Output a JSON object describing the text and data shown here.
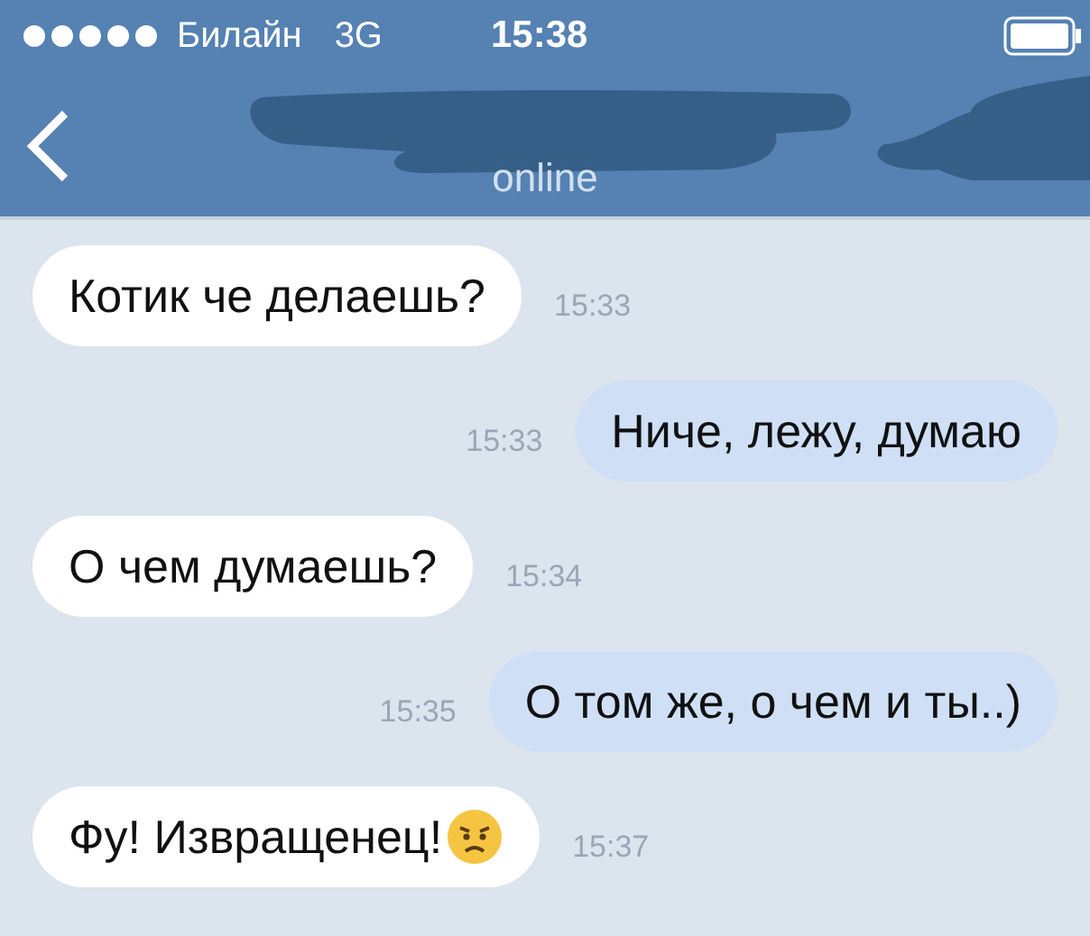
{
  "status_bar": {
    "carrier": "Билайн",
    "network": "3G",
    "time": "15:38"
  },
  "nav": {
    "subtitle": "online"
  },
  "messages": [
    {
      "kind": "incoming",
      "text": "Котик че делаешь?",
      "time": "15:33",
      "emoji": false
    },
    {
      "kind": "outgoing",
      "text": "Ниче, лежу, думаю",
      "time": "15:33",
      "emoji": false
    },
    {
      "kind": "incoming",
      "text": "О чем думаешь?",
      "time": "15:34",
      "emoji": false
    },
    {
      "kind": "outgoing",
      "text": "О том же, о чем и ты..)",
      "time": "15:35",
      "emoji": false
    },
    {
      "kind": "incoming",
      "text": "Фу! Извращенец!",
      "time": "15:37",
      "emoji": true
    }
  ]
}
